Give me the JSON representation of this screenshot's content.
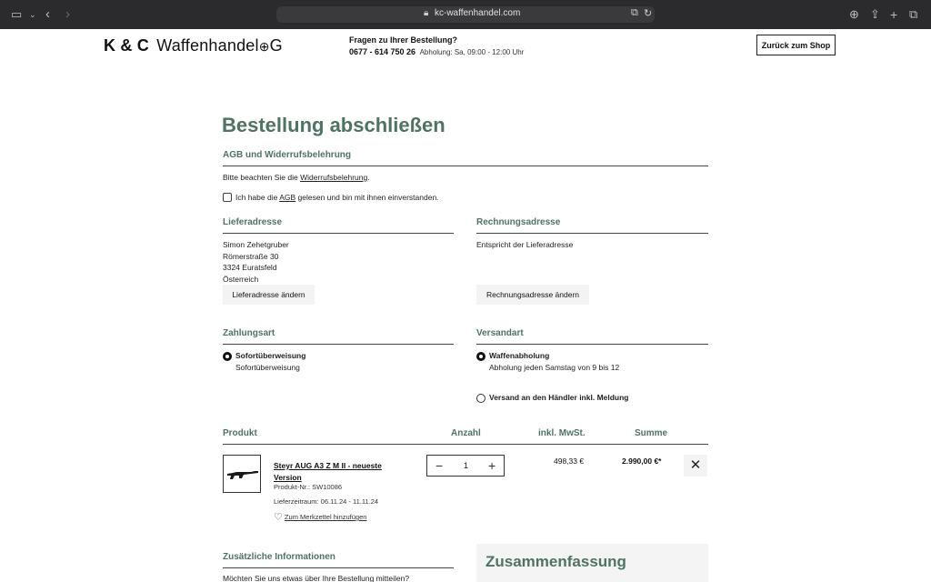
{
  "browser": {
    "url": "kc-waffenhandel.com",
    "icons": [
      "sidebar-icon",
      "chevron-down-icon",
      "back-icon",
      "forward-icon",
      "lock-icon",
      "translate-icon",
      "reload-icon",
      "download-icon",
      "share-icon",
      "new-tab-icon",
      "tabs-icon"
    ]
  },
  "header": {
    "logo_bold": "K & C",
    "logo_text": "Waffenhandel",
    "logo_suffix": "G",
    "contact_question": "Fragen zu Ihrer Bestellung?",
    "phone": "0677 - 614 750 26",
    "pickup_hours": "Abholung: Sa, 09:00 - 12:00 Uhr",
    "back_button": "Zurück zum Shop"
  },
  "page": {
    "title": "Bestellung abschließen"
  },
  "agb": {
    "heading": "AGB und Widerrufsbelehrung",
    "notice_prefix": "Bitte beachten Sie die ",
    "notice_link": "Widerrufsbelehrung",
    "notice_suffix": ".",
    "checkbox_prefix": "Ich habe die ",
    "checkbox_link": "AGB",
    "checkbox_suffix": " gelesen und bin mit ihnen einverstanden.",
    "checked": false
  },
  "delivery": {
    "heading": "Lieferadresse",
    "name": "Simon Zehetgruber",
    "street": "Römerstraße 30",
    "city": "3324 Euratsfeld",
    "country": "Österreich",
    "change_button": "Lieferadresse ändern"
  },
  "billing": {
    "heading": "Rechnungsadresse",
    "text": "Entspricht der Lieferadresse",
    "change_button": "Rechnungsadresse ändern"
  },
  "payment": {
    "heading": "Zahlungsart",
    "option_title": "Sofortüberweisung",
    "option_sub": "Sofortüberweisung",
    "selected": true
  },
  "shipping": {
    "heading": "Versandart",
    "options": [
      {
        "title": "Waffenabholung",
        "sub": "Abholung jeden Samstag von 9 bis 12",
        "selected": true
      },
      {
        "title": "Versand an den Händler inkl. Meldung",
        "sub": "",
        "selected": false
      }
    ]
  },
  "cart": {
    "headers": {
      "product": "Produkt",
      "quantity": "Anzahl",
      "vat": "inkl. MwSt.",
      "total": "Summe"
    },
    "items": [
      {
        "name": "Steyr AUG A3 Z M II - neueste Version",
        "sku": "Produkt-Nr.: SW10086",
        "delivery": "Lieferzeitraum: 06.11.24 - 11.11.24",
        "wishlist": "Zum Merkzettel hinzufügen",
        "quantity": "1",
        "vat": "498,33 €",
        "total": "2.990,00 €*"
      }
    ]
  },
  "extra": {
    "heading": "Zusätzliche Informationen",
    "question": "Möchten Sie uns etwas über Ihre Bestellung mitteilen?"
  },
  "summary": {
    "title": "Zusammenfassung"
  }
}
